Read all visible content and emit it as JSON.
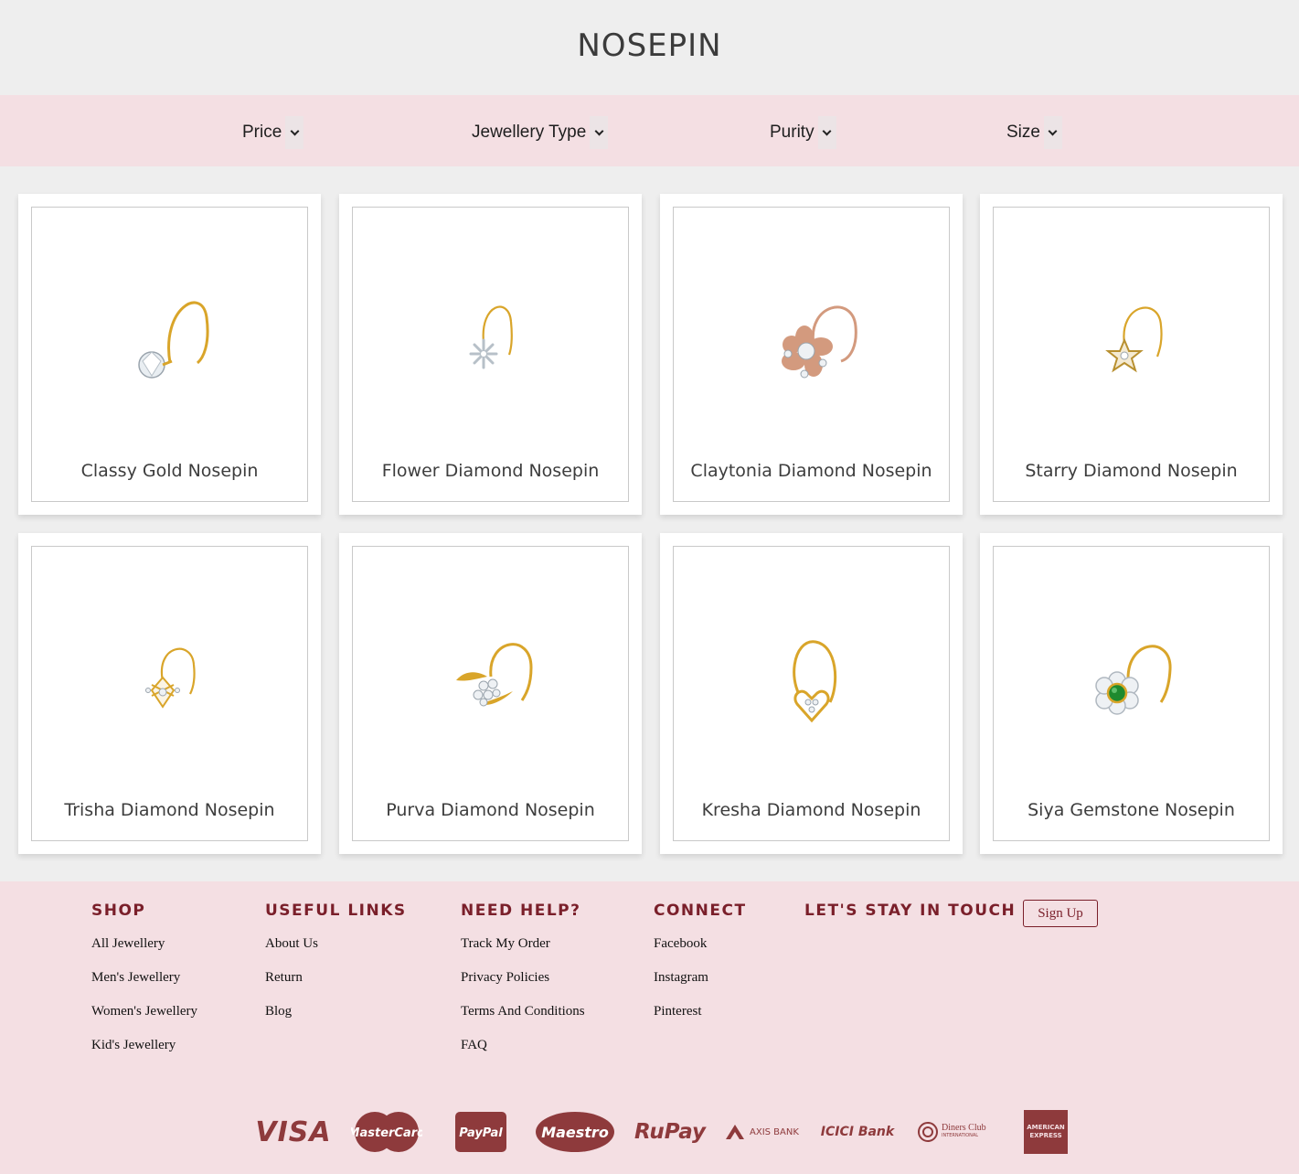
{
  "page": {
    "title": "NOSEPIN"
  },
  "filters": [
    {
      "label": "Price"
    },
    {
      "label": "Jewellery Type"
    },
    {
      "label": "Purity"
    },
    {
      "label": "Size"
    }
  ],
  "products": [
    {
      "name": "Classy Gold Nosepin",
      "icon": "classy-gold-nosepin-image"
    },
    {
      "name": "Flower Diamond Nosepin",
      "icon": "flower-diamond-nosepin-image"
    },
    {
      "name": "Claytonia Diamond Nosepin",
      "icon": "claytonia-diamond-nosepin-image"
    },
    {
      "name": "Starry Diamond Nosepin",
      "icon": "starry-diamond-nosepin-image"
    },
    {
      "name": "Trisha Diamond Nosepin",
      "icon": "trisha-diamond-nosepin-image"
    },
    {
      "name": "Purva Diamond Nosepin",
      "icon": "purva-diamond-nosepin-image"
    },
    {
      "name": "Kresha Diamond Nosepin",
      "icon": "kresha-diamond-nosepin-image"
    },
    {
      "name": "Siya Gemstone Nosepin",
      "icon": "siya-gemstone-nosepin-image"
    }
  ],
  "footer": {
    "shop": {
      "heading": "SHOP",
      "links": [
        "All Jewellery",
        "Men's Jewellery",
        "Women's Jewellery",
        "Kid's Jewellery"
      ]
    },
    "useful": {
      "heading": "USEFUL LINKS",
      "links": [
        "About Us",
        "Return",
        "Blog"
      ]
    },
    "help": {
      "heading": "NEED HELP?",
      "links": [
        "Track My Order",
        "Privacy Policies",
        "Terms And Conditions",
        "FAQ"
      ]
    },
    "connect": {
      "heading": "CONNECT",
      "links": [
        "Facebook",
        "Instagram",
        "Pinterest"
      ]
    },
    "touch": {
      "heading": "LET'S STAY IN TOUCH",
      "signup_label": "Sign Up"
    }
  },
  "payments": {
    "visa": "VISA",
    "mastercard": "MasterCard",
    "paypal": "PayPal",
    "maestro": "Maestro",
    "rupay": "RuPay",
    "axis": "AXIS BANK",
    "icici": "ICICI Bank",
    "diners_1": "Diners Club",
    "diners_2": "INTERNATIONAL",
    "amex_1": "AMERICAN",
    "amex_2": "EXPRESS"
  },
  "colors": {
    "footer_bg": "#f4dfe3",
    "accent": "#7a1f2a",
    "payment": "#8e3a3c",
    "gold": "#d9a52a",
    "rose": "#d39a7e"
  }
}
